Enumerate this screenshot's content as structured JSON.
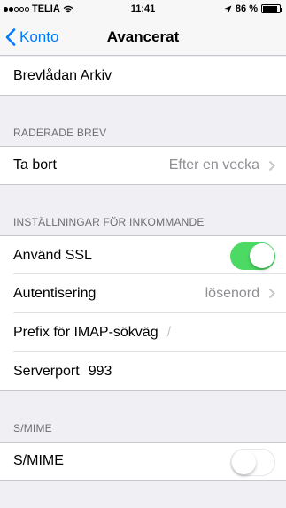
{
  "statusbar": {
    "carrier": "TELIA",
    "time": "11:41",
    "battery_percent": "86 %"
  },
  "nav": {
    "back_label": "Konto",
    "title": "Avancerat"
  },
  "mailbox": {
    "archive_label": "Brevlådan Arkiv"
  },
  "deleted": {
    "header": "RADERADE BREV",
    "remove_label": "Ta bort",
    "remove_value": "Efter en vecka"
  },
  "incoming": {
    "header": "INSTÄLLNINGAR FÖR INKOMMANDE",
    "ssl_label": "Använd SSL",
    "ssl_on": true,
    "auth_label": "Autentisering",
    "auth_value": "lösenord",
    "prefix_label": "Prefix för IMAP-sökväg",
    "prefix_value": "/",
    "port_label": "Serverport",
    "port_value": "993"
  },
  "smime": {
    "header": "S/MIME",
    "label": "S/MIME",
    "enabled": false
  },
  "colors": {
    "accent": "#007aff",
    "switch_on": "#4cd964",
    "background": "#efeff4"
  }
}
